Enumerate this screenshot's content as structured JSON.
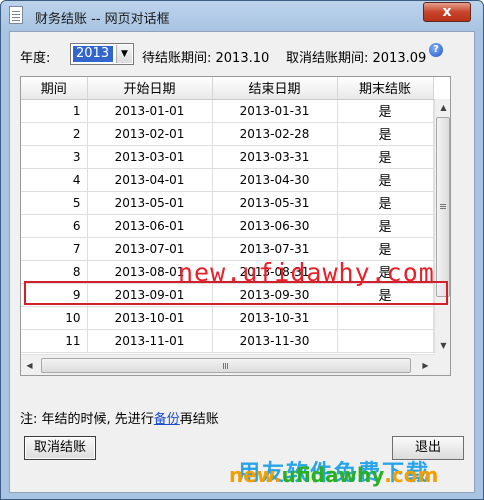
{
  "window": {
    "title": "财务结账 -- 网页对话框",
    "close_label": "x"
  },
  "year": {
    "label": "年度:",
    "value": "2013"
  },
  "pending": {
    "text": "待结账期间: 2013.10"
  },
  "cancel_period": {
    "text": "取消结账期间: 2013.09"
  },
  "table": {
    "headers": [
      "期间",
      "开始日期",
      "结束日期",
      "期末结账"
    ],
    "rows": [
      {
        "period": "1",
        "start": "2013-01-01",
        "end": "2013-01-31",
        "closed": "是"
      },
      {
        "period": "2",
        "start": "2013-02-01",
        "end": "2013-02-28",
        "closed": "是"
      },
      {
        "period": "3",
        "start": "2013-03-01",
        "end": "2013-03-31",
        "closed": "是"
      },
      {
        "period": "4",
        "start": "2013-04-01",
        "end": "2013-04-30",
        "closed": "是"
      },
      {
        "period": "5",
        "start": "2013-05-01",
        "end": "2013-05-31",
        "closed": "是"
      },
      {
        "period": "6",
        "start": "2013-06-01",
        "end": "2013-06-30",
        "closed": "是"
      },
      {
        "period": "7",
        "start": "2013-07-01",
        "end": "2013-07-31",
        "closed": "是"
      },
      {
        "period": "8",
        "start": "2013-08-01",
        "end": "2013-08-31",
        "closed": "是"
      },
      {
        "period": "9",
        "start": "2013-09-01",
        "end": "2013-09-30",
        "closed": "是"
      },
      {
        "period": "10",
        "start": "2013-10-01",
        "end": "2013-10-31",
        "closed": ""
      },
      {
        "period": "11",
        "start": "2013-11-01",
        "end": "2013-11-30",
        "closed": ""
      }
    ],
    "highlighted_period": "9"
  },
  "note": {
    "prefix": "注: 年结的时候, 先进行",
    "link": "备份",
    "suffix": "再结账"
  },
  "buttons": {
    "cancel_close": "取消结账",
    "exit": "退出"
  },
  "watermark": {
    "middle": "new.ufidawhy.com",
    "brand": "用友软件免费下载",
    "site_prefix": "new.",
    "site_main": "ufidawhy",
    "site_suffix": ".com"
  },
  "colors": {
    "highlight_border": "#d2202a",
    "selection": "#3366cc",
    "link": "#1a4ccc"
  }
}
